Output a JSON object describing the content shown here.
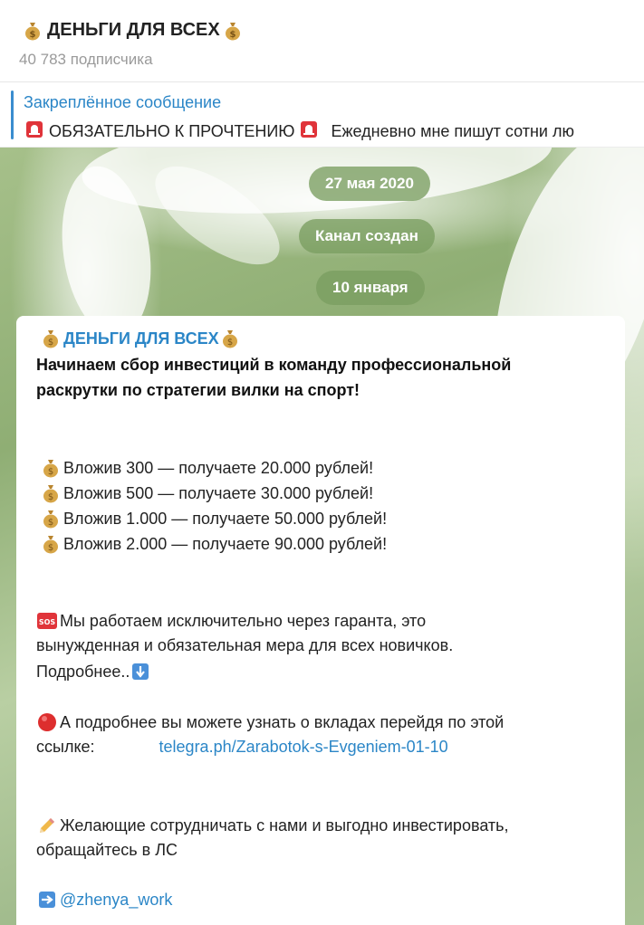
{
  "channel": {
    "name": "ДЕНЬГИ ДЛЯ ВСЕХ",
    "subscribers": "40 783 подписчика"
  },
  "pinned": {
    "title": "Закреплённое сообщение",
    "text": "ОБЯЗАТЕЛЬНО К ПРОЧТЕНИЮ",
    "preview": "Ежедневно мне пишут сотни лю"
  },
  "service": {
    "date1": "27 мая 2020",
    "created": "Канал создан",
    "date2": "10 января"
  },
  "message": {
    "author": "ДЕНЬГИ ДЛЯ ВСЕХ",
    "headline1": "Начинаем  сбор инвестиций в команду профессиональной",
    "headline2": "раскрутки по стратегии вилки на спорт!",
    "offers": [
      "Вложив 300 — получаете 20.000 рублей!",
      "Вложив 500 — получаете 30.000 рублей!",
      "Вложив 1.000 — получаете 50.000 рублей!",
      "Вложив 2.000 — получаете 90.000 рублей!"
    ],
    "guarantee1": "Мы работаем исключительно через гаранта, это",
    "guarantee2": "вынужденная и обязательная мера для всех новичков.",
    "guarantee3": "Подробнее..",
    "details1": "А подробнее вы можете узнать о вкладах перейдя по этой",
    "details2": "ссылке:",
    "details_link": "telegra.ph/Zarabotok-s-Evgeniem-01-10",
    "cooperate1": "Желающие сотрудничать с нами и выгодно инвестировать,",
    "cooperate2": "обращайтесь в ЛС",
    "contact": "@zhenya_work"
  },
  "colors": {
    "accent": "#2b86c7",
    "pill": "#7a9e60"
  },
  "icons": [
    "money-bag-icon",
    "siren-icon",
    "sos-icon",
    "down-arrow-icon",
    "red-circle-icon",
    "pencil-icon",
    "right-arrow-icon"
  ]
}
